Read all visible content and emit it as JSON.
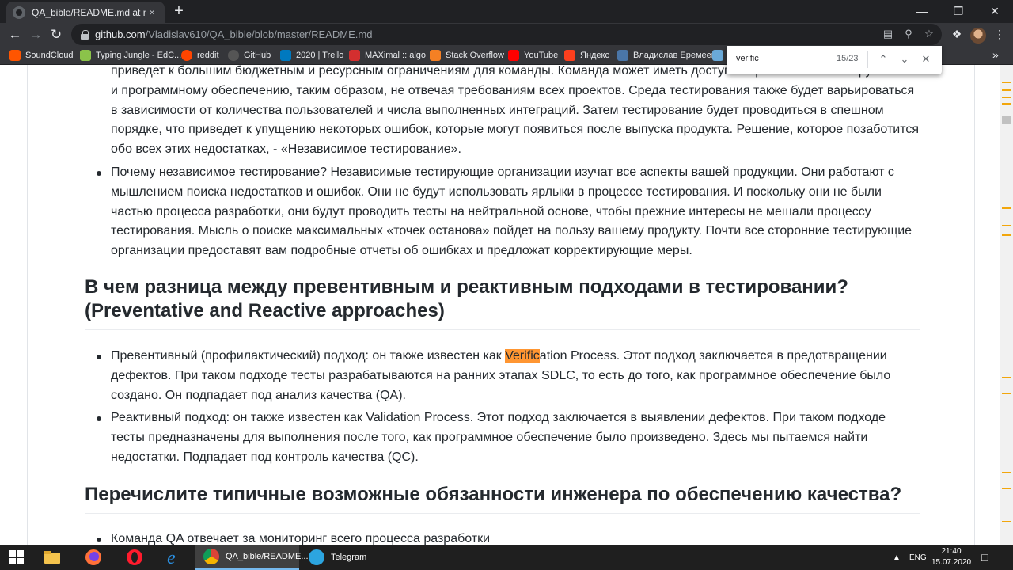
{
  "browser": {
    "tab_title": "QA_bible/README.md at master",
    "tab_close": "×",
    "new_tab": "+",
    "url_host": "github.com",
    "url_path": "/Vladislav610/QA_bible/blob/master/README.md",
    "bookmarks": [
      {
        "label": "SoundCloud",
        "color": "#ff5500"
      },
      {
        "label": "Typing Jungle - EdC...",
        "color": "#8bc34a"
      },
      {
        "label": "reddit",
        "color": "#ff4500"
      },
      {
        "label": "GitHub",
        "color": "#24292e"
      },
      {
        "label": "2020 | Trello",
        "color": "#0079bf"
      },
      {
        "label": "MAXimal :: algo",
        "color": "#d32f2f"
      },
      {
        "label": "Stack Overflow",
        "color": "#f48024"
      },
      {
        "label": "YouTube",
        "color": "#ff0000"
      },
      {
        "label": "Яндекс",
        "color": "#fc3f1d"
      },
      {
        "label": "Владислав Еремеев",
        "color": "#4a76a8"
      }
    ],
    "find": {
      "query": "verific",
      "count": "15/23"
    }
  },
  "article": {
    "intro_item": "приведет к большим бюджетным и ресурсным ограничениям для команды. Команда может иметь доступ к ограниченным инструментам и программному обеспечению, таким образом, не отвечая требованиям всех проектов. Среда тестирования также будет варьироваться в зависимости от количества пользователей и числа выполненных интеграций. Затем тестирование будет проводиться в спешном порядке, что приведет к упущению некоторых ошибок, которые могут появиться после выпуска продукта. Решение, которое позаботится обо всех этих недостатках, - «Независимое тестирование».",
    "why_item": "Почему независимое тестирование? Независимые тестирующие организации изучат все аспекты вашей продукции. Они работают с мышлением поиска недостатков и ошибок. Они не будут использовать ярлыки в процессе тестирования. И поскольку они не были частью процесса разработки, они будут проводить тесты на нейтральной основе, чтобы прежние интересы не мешали процессу тестирования. Мысль о поиске максимальных «точек останова» пойдет на пользу вашему продукту. Почти все сторонние тестирующие организации предоставят вам подробные отчеты об ошибках и предложат корректирующие меры.",
    "heading1": "В чем разница между превентивным и реактивным подходами в тестировании? (Preventative and Reactive approaches)",
    "prev_before": "Превентивный (профилактический) подход: он также известен как ",
    "prev_highlight": "Verific",
    "prev_after": "ation Process. Этот подход заключается в предотвращении дефектов. При таком подходе тесты разрабатываются на ранних этапах SDLC, то есть до того, как программное обеспечение было создано. Он подпадает под анализ качества (QA).",
    "react_item": "Реактивный подход: он также известен как Validation Process. Этот подход заключается в выявлении дефектов. При таком подходе тесты предназначены для выполнения после того, как программное обеспечение было произведено. Здесь мы пытаемся найти недостатки. Подпадает под контроль качества (QC).",
    "heading2": "Перечислите типичные возможные обязанности инженера по обеспечению качества?",
    "next_item": "Команда QA отвечает за мониторинг всего процесса разработки"
  },
  "taskbar": {
    "apps": [
      {
        "label": "QA_bible/README...",
        "active": true
      },
      {
        "label": "Telegram",
        "active": false
      }
    ],
    "tray_arrow": "▲",
    "lang": "ENG",
    "time": "21:40",
    "date": "15.07.2020"
  },
  "colors": {
    "find_highlight": "#ff9632",
    "chrome_dark": "#202124",
    "chrome_toolbar": "#35363a"
  }
}
